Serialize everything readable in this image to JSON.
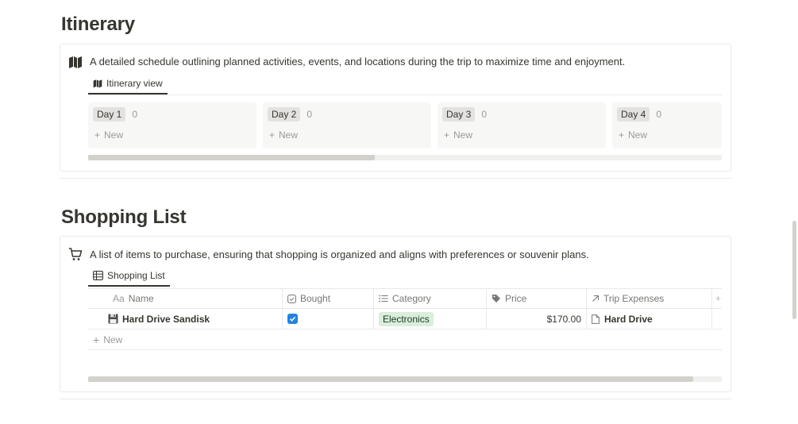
{
  "itinerary": {
    "title": "Itinerary",
    "icon": "map-icon",
    "description": "A detailed schedule outlining planned activities, events, and locations during the trip to maximize time and enjoyment.",
    "view_tab": "Itinerary view",
    "columns": [
      {
        "label": "Day 1",
        "count": "0",
        "new_label": "New"
      },
      {
        "label": "Day 2",
        "count": "0",
        "new_label": "New"
      },
      {
        "label": "Day 3",
        "count": "0",
        "new_label": "New"
      },
      {
        "label": "Day 4",
        "count": "0",
        "new_label": "New"
      }
    ]
  },
  "shopping": {
    "title": "Shopping List",
    "icon": "cart-icon",
    "description": "A list of items to purchase, ensuring that shopping is organized and aligns with preferences or souvenir plans.",
    "view_tab": "Shopping List",
    "headers": {
      "name_prefix": "Aa",
      "name": "Name",
      "bought": "Bought",
      "category": "Category",
      "price": "Price",
      "trip_expenses": "Trip Expenses",
      "add_column": "+"
    },
    "rows": [
      {
        "icon": "floppy-disk-icon",
        "name": "Hard Drive Sandisk",
        "bought": true,
        "category": "Electronics",
        "price": "$170.00",
        "trip_expense": "Hard Drive"
      }
    ],
    "new_label": "New"
  },
  "colors": {
    "text": "#37352f",
    "muted": "#9b9a97",
    "checkbox": "#2383e2",
    "tag_green_bg": "#dbeddb"
  }
}
